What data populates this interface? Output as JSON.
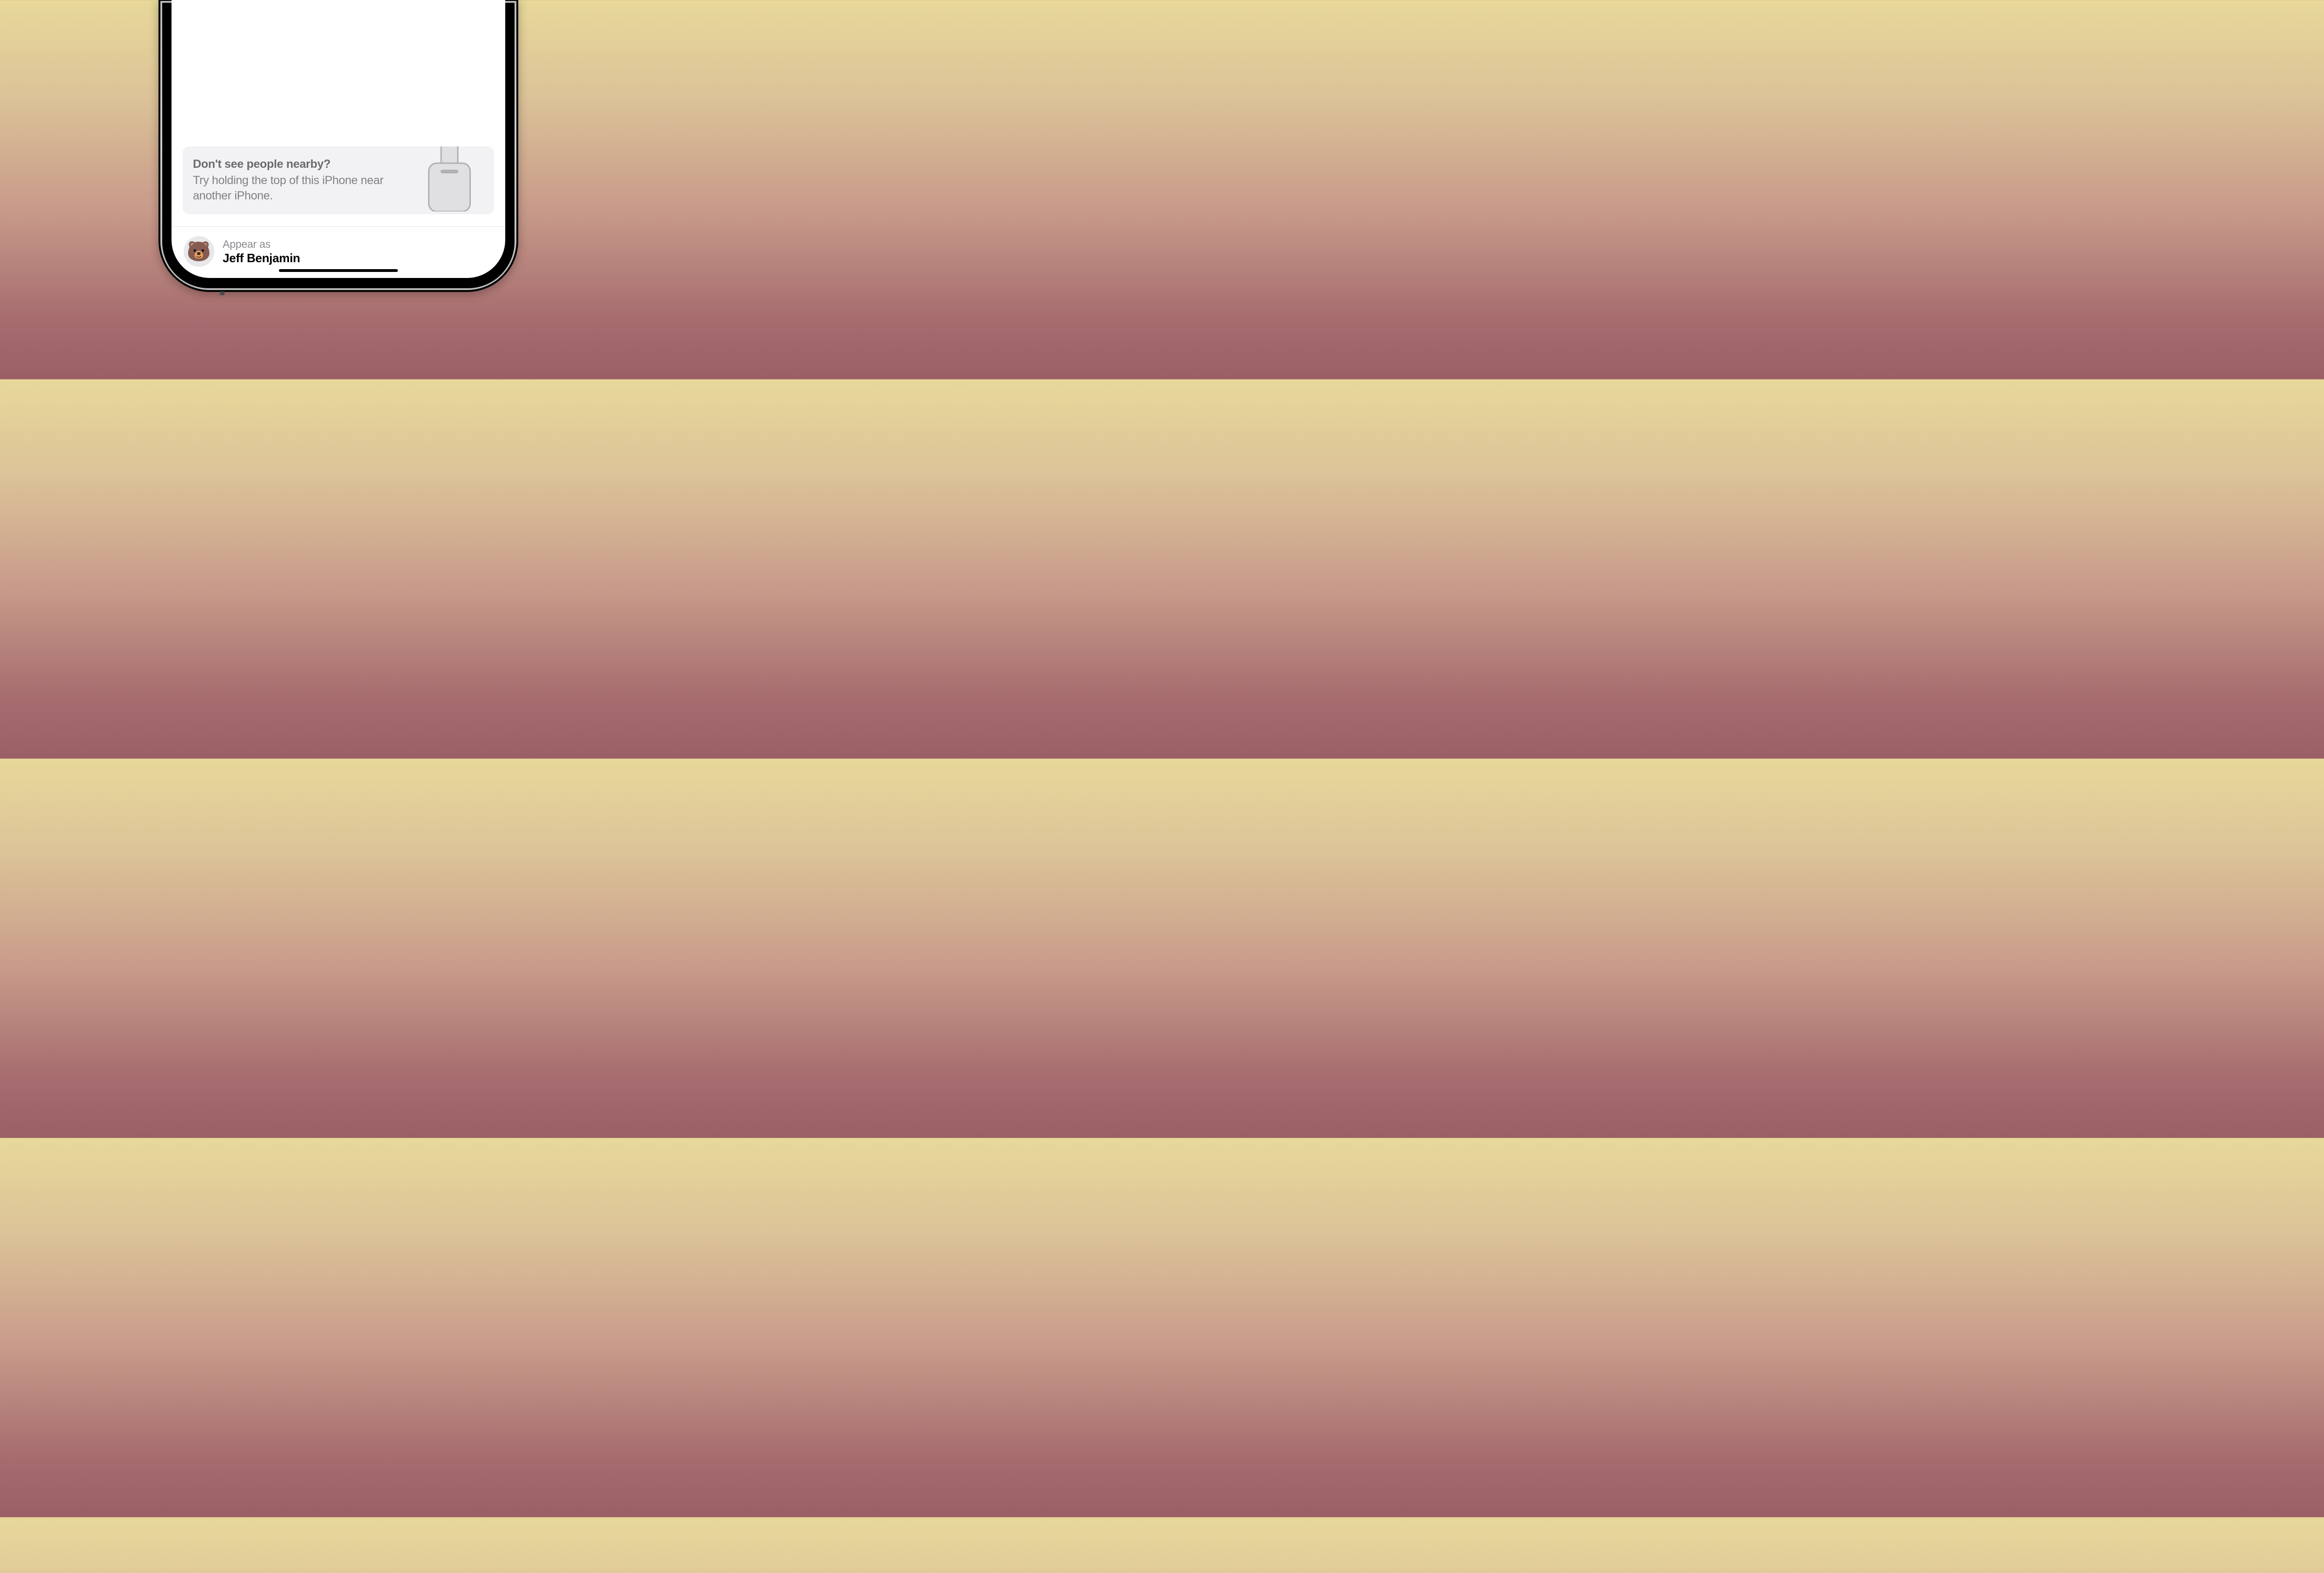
{
  "hint": {
    "title": "Don't see people nearby?",
    "description": "Try holding the top of this iPhone near another iPhone."
  },
  "profile": {
    "appear_as_label": "Appear as",
    "name": "Jeff Benjamin",
    "avatar_emoji": "🐻"
  }
}
